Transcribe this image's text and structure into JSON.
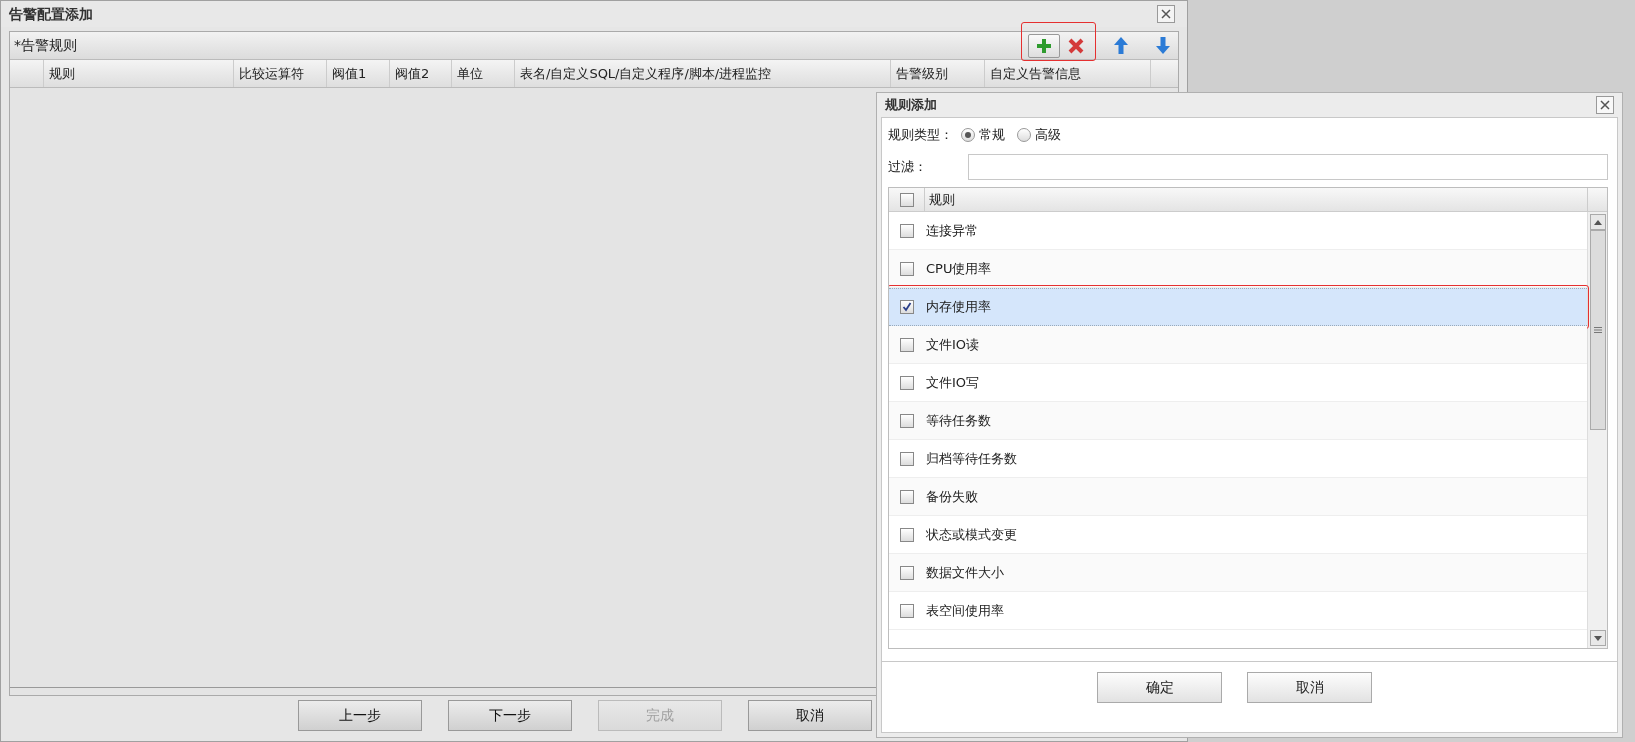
{
  "window": {
    "title": "告警配置添加"
  },
  "panel": {
    "title": "*告警规则",
    "columns": [
      "规则",
      "比较运算符",
      "阀值1",
      "阀值2",
      "单位",
      "表名/自定义SQL/自定义程序/脚本/进程监控",
      "告警级别",
      "自定义告警信息"
    ]
  },
  "buttons": [
    {
      "label": "上一步",
      "disabled": false
    },
    {
      "label": "下一步",
      "disabled": false
    },
    {
      "label": "完成",
      "disabled": true
    },
    {
      "label": "取消",
      "disabled": false
    }
  ],
  "dialog": {
    "title": "规则添加",
    "rule_type_label": "规则类型：",
    "rule_types": [
      {
        "label": "常规",
        "selected": true
      },
      {
        "label": "高级",
        "selected": false
      }
    ],
    "filter_label": "过滤：",
    "header_checked": false,
    "list_header": "规则",
    "rules": [
      {
        "label": "连接异常",
        "checked": false
      },
      {
        "label": "CPU使用率",
        "checked": false
      },
      {
        "label": "内存使用率",
        "checked": true
      },
      {
        "label": "文件IO读",
        "checked": false
      },
      {
        "label": "文件IO写",
        "checked": false
      },
      {
        "label": "等待任务数",
        "checked": false
      },
      {
        "label": "归档等待任务数",
        "checked": false
      },
      {
        "label": "备份失败",
        "checked": false
      },
      {
        "label": "状态或模式变更",
        "checked": false
      },
      {
        "label": "数据文件大小",
        "checked": false
      },
      {
        "label": "表空间使用率",
        "checked": false
      }
    ],
    "buttons": [
      "确定",
      "取消"
    ]
  }
}
